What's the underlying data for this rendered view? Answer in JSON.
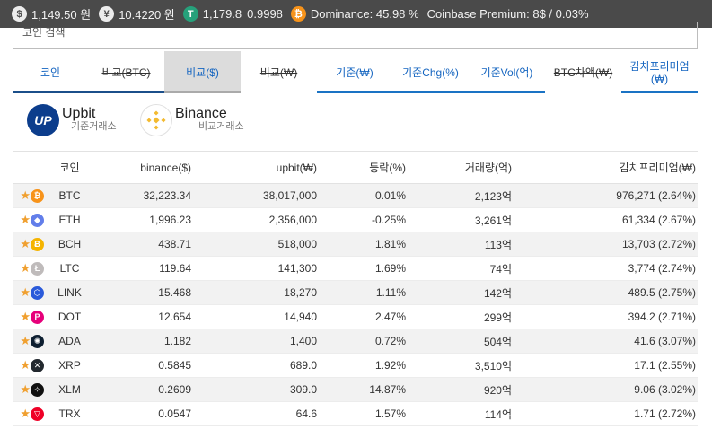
{
  "ticker": {
    "usd_value": "1,149.50 원",
    "jpy_value": "10.4220 원",
    "usdt_value": "1,179.8",
    "usdt_ratio": "0.9998",
    "dominance": "Dominance: 45.98 %",
    "premium": "Coinbase Premium: 8$ / 0.03%"
  },
  "search": {
    "placeholder": "코인 검색"
  },
  "tabs": [
    {
      "label": "코인"
    },
    {
      "label": "비교(BTC)"
    },
    {
      "label": "비교($)"
    },
    {
      "label": "비교(₩)"
    },
    {
      "label": "기준(₩)"
    },
    {
      "label": "기준Chg(%)"
    },
    {
      "label": "기준Vol(억)"
    },
    {
      "label": "BTC차액(₩)"
    },
    {
      "label": "김치프리미엄(₩)"
    }
  ],
  "exchanges": {
    "base": {
      "name": "Upbit",
      "sub": "기준거래소",
      "logo_text": "UP"
    },
    "compare": {
      "name": "Binance",
      "sub": "비교거래소"
    }
  },
  "table": {
    "headers": {
      "coin": "코인",
      "binance": "binance($)",
      "upbit": "upbit(₩)",
      "change": "등락(%)",
      "volume": "거래량(억)",
      "kimchi": "김치프리미엄(₩)"
    },
    "rows": [
      {
        "sym": "BTC",
        "binance": "32,223.34",
        "upbit": "38,017,000",
        "change": "0.01%",
        "volume": "2,123억",
        "kimchi": "976,271 (2.64%)",
        "color": "#f7931a",
        "glyph": "₿"
      },
      {
        "sym": "ETH",
        "binance": "1,996.23",
        "upbit": "2,356,000",
        "change": "-0.25%",
        "volume": "3,261억",
        "kimchi": "61,334 (2.67%)",
        "color": "#627eea",
        "glyph": "◆"
      },
      {
        "sym": "BCH",
        "binance": "438.71",
        "upbit": "518,000",
        "change": "1.81%",
        "volume": "113억",
        "kimchi": "13,703 (2.72%)",
        "color": "#f5b400",
        "glyph": "Ƀ"
      },
      {
        "sym": "LTC",
        "binance": "119.64",
        "upbit": "141,300",
        "change": "1.69%",
        "volume": "74억",
        "kimchi": "3,774 (2.74%)",
        "color": "#bfbbbb",
        "glyph": "Ł"
      },
      {
        "sym": "LINK",
        "binance": "15.468",
        "upbit": "18,270",
        "change": "1.11%",
        "volume": "142억",
        "kimchi": "489.5 (2.75%)",
        "color": "#2a5ada",
        "glyph": "⬡"
      },
      {
        "sym": "DOT",
        "binance": "12.654",
        "upbit": "14,940",
        "change": "2.47%",
        "volume": "299억",
        "kimchi": "394.2 (2.71%)",
        "color": "#e6007a",
        "glyph": "P"
      },
      {
        "sym": "ADA",
        "binance": "1.182",
        "upbit": "1,400",
        "change": "0.72%",
        "volume": "504억",
        "kimchi": "41.6 (3.07%)",
        "color": "#0d1e30",
        "glyph": "✺"
      },
      {
        "sym": "XRP",
        "binance": "0.5845",
        "upbit": "689.0",
        "change": "1.92%",
        "volume": "3,510억",
        "kimchi": "17.1 (2.55%)",
        "color": "#23292f",
        "glyph": "✕"
      },
      {
        "sym": "XLM",
        "binance": "0.2609",
        "upbit": "309.0",
        "change": "14.87%",
        "volume": "920억",
        "kimchi": "9.06 (3.02%)",
        "color": "#111111",
        "glyph": "✧"
      },
      {
        "sym": "TRX",
        "binance": "0.0547",
        "upbit": "64.6",
        "change": "1.57%",
        "volume": "114억",
        "kimchi": "1.71 (2.72%)",
        "color": "#ef0027",
        "glyph": "▽"
      }
    ]
  }
}
